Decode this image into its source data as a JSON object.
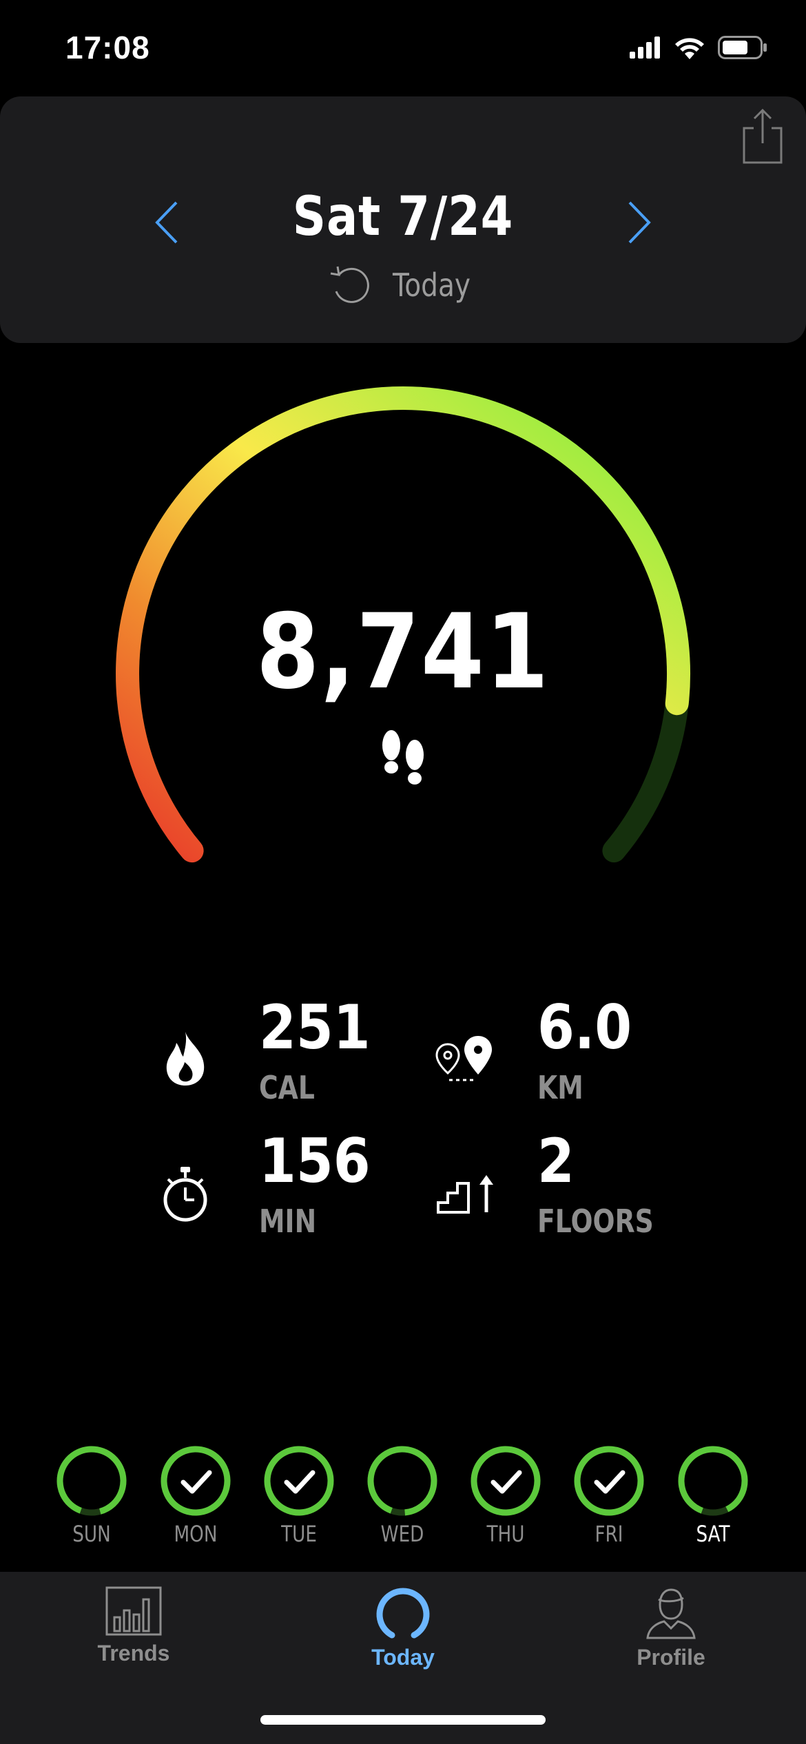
{
  "status_bar": {
    "time": "17:08",
    "icons": [
      "cellular-signal-icon",
      "wifi-icon",
      "battery-icon"
    ]
  },
  "header": {
    "date": "Sat 7/24",
    "today_label": "Today",
    "icons": [
      "share-icon",
      "chevron-left-icon",
      "chevron-right-icon",
      "refresh-icon"
    ]
  },
  "gauge": {
    "steps": "8,741",
    "progress": 0.87,
    "colors": {
      "start": "#e8392a",
      "mid": "#f9e94a",
      "end": "#7aee3c",
      "track": "#15300d"
    }
  },
  "stats": [
    {
      "icon": "flame-icon",
      "value": "251",
      "unit": "CAL"
    },
    {
      "icon": "location-pins-icon",
      "value": "6.0",
      "unit": "KM"
    },
    {
      "icon": "stopwatch-icon",
      "value": "156",
      "unit": "MIN"
    },
    {
      "icon": "stairs-icon",
      "value": "2",
      "unit": "FLOORS"
    }
  ],
  "week": [
    {
      "label": "SUN",
      "completed": false,
      "progress": 0.9
    },
    {
      "label": "MON",
      "completed": true,
      "progress": 1.0
    },
    {
      "label": "TUE",
      "completed": true,
      "progress": 1.0
    },
    {
      "label": "WED",
      "completed": false,
      "progress": 0.93
    },
    {
      "label": "THU",
      "completed": true,
      "progress": 1.0
    },
    {
      "label": "FRI",
      "completed": true,
      "progress": 1.0
    },
    {
      "label": "SAT",
      "completed": false,
      "progress": 0.87,
      "active": true
    }
  ],
  "tabs": [
    {
      "label": "Trends",
      "icon": "bar-chart-icon",
      "active": false
    },
    {
      "label": "Today",
      "icon": "ring-icon",
      "active": true
    },
    {
      "label": "Profile",
      "icon": "person-icon",
      "active": false
    }
  ],
  "accent_color": "#6cb6ff",
  "ring_color": "#5cc93c"
}
